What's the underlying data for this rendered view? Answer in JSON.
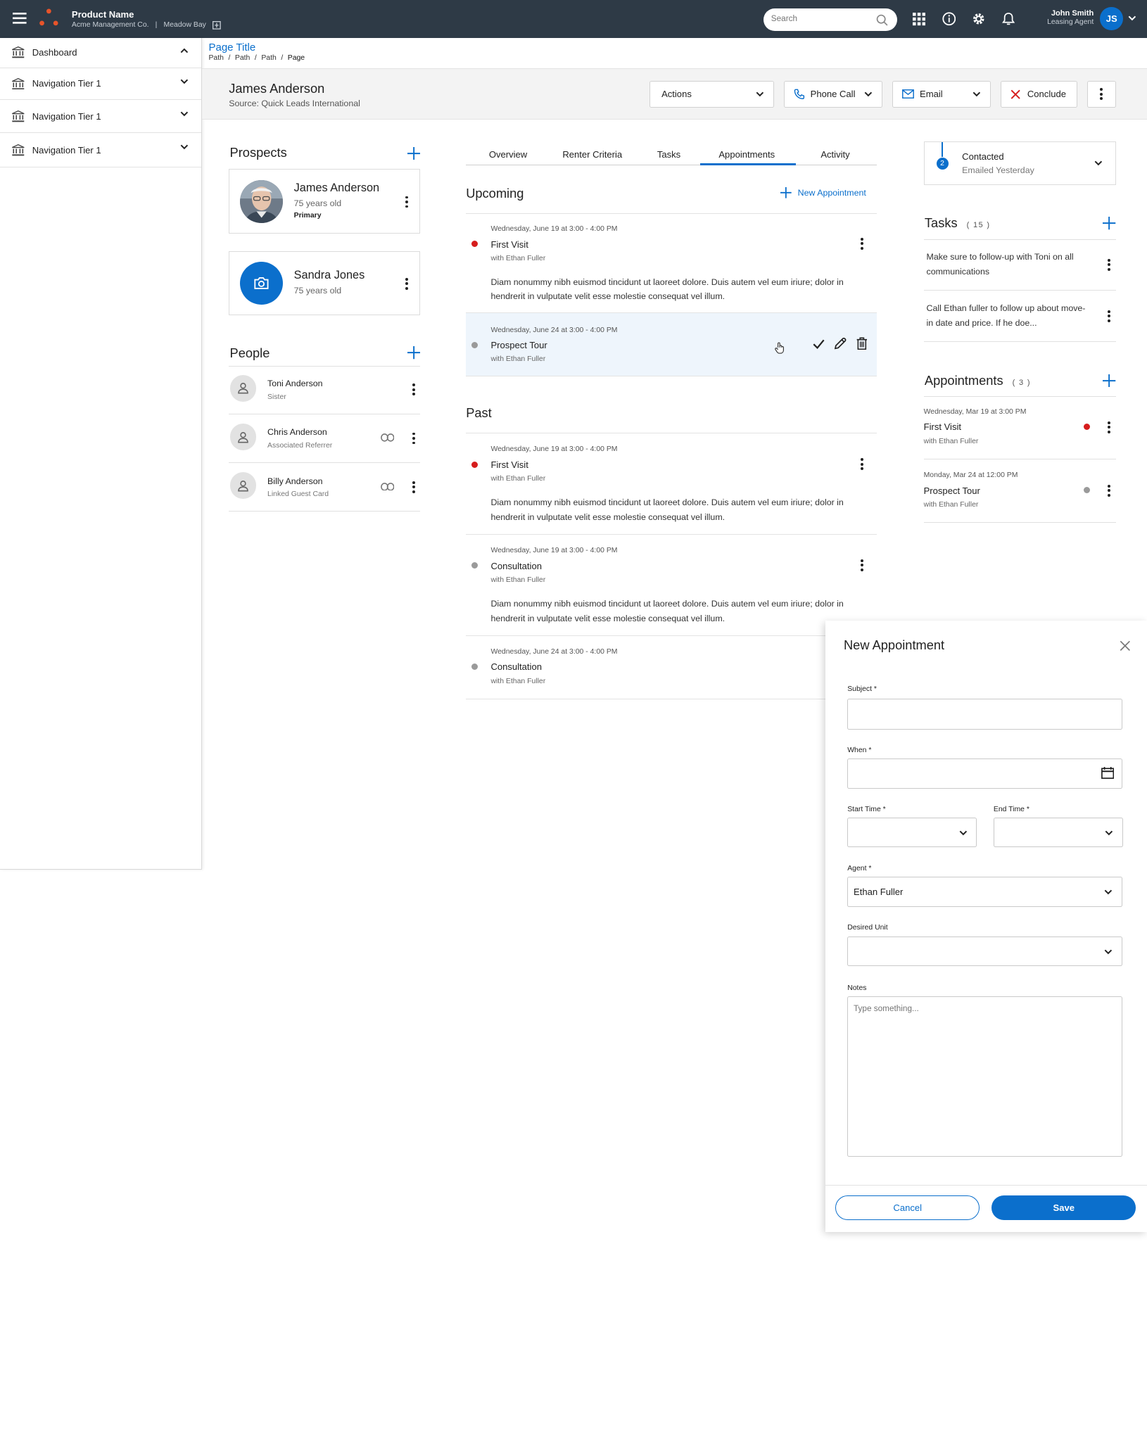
{
  "header": {
    "product_name": "Product Name",
    "company": "Acme Management Co.",
    "separator": "|",
    "property": "Meadow Bay",
    "search_placeholder": "Search",
    "user_name": "John Smith",
    "user_role": "Leasing Agent",
    "user_initials": "JS"
  },
  "sidebar": {
    "items": [
      {
        "label": "Dashboard",
        "expanded": true
      },
      {
        "label": "Navigation Tier 1",
        "expanded": false
      },
      {
        "label": "Navigation Tier 1",
        "expanded": false
      },
      {
        "label": "Navigation Tier 1",
        "expanded": false
      }
    ]
  },
  "page": {
    "title": "Page Title",
    "breadcrumb": [
      "Path",
      "Path",
      "Path",
      "Page"
    ],
    "breadcrumb_sep": "/"
  },
  "contact": {
    "name": "James Anderson",
    "source": "Source: Quick Leads International"
  },
  "toolbar": {
    "actions": "Actions",
    "phone": "Phone Call",
    "email": "Email",
    "conclude": "Conclude"
  },
  "prospects": {
    "title": "Prospects",
    "items": [
      {
        "name": "James Anderson",
        "age": "75 years old",
        "tag": "Primary"
      },
      {
        "name": "Sandra Jones",
        "age": "75 years old"
      }
    ]
  },
  "people": {
    "title": "People",
    "items": [
      {
        "name": "Toni Anderson",
        "relation": "Sister"
      },
      {
        "name": "Chris Anderson",
        "relation": "Associated Referrer"
      },
      {
        "name": "Billy Anderson",
        "relation": "Linked Guest Card"
      }
    ]
  },
  "tabs": [
    "Overview",
    "Renter Criteria",
    "Tasks",
    "Appointments",
    "Activity"
  ],
  "active_tab": "Appointments",
  "upcoming": {
    "title": "Upcoming",
    "new_label": "New Appointment",
    "items": [
      {
        "date": "Wednesday, June 19 at 3:00 - 4:00 PM",
        "title": "First Visit",
        "with": "with Ethan Fuller",
        "desc": "Diam nonummy nibh euismod tincidunt ut laoreet dolore. Duis autem vel eum iriure; dolor in hendrerit in vulputate velit esse molestie consequat vel illum.",
        "status": "red"
      },
      {
        "date": "Wednesday, June 24 at 3:00 - 4:00 PM",
        "title": "Prospect Tour",
        "with": "with Ethan Fuller",
        "status": "grey"
      }
    ]
  },
  "past": {
    "title": "Past",
    "items": [
      {
        "date": "Wednesday, June 19 at 3:00 - 4:00 PM",
        "title": "First Visit",
        "with": "with Ethan Fuller",
        "desc": "Diam nonummy nibh euismod tincidunt ut laoreet dolore. Duis autem vel eum iriure; dolor in hendrerit in vulputate velit esse molestie consequat vel illum.",
        "status": "red"
      },
      {
        "date": "Wednesday, June 19 at 3:00 - 4:00 PM",
        "title": "Consultation",
        "with": "with Ethan Fuller",
        "desc": "Diam nonummy nibh euismod tincidunt ut laoreet dolore. Duis autem vel eum iriure; dolor in hendrerit in vulputate velit esse molestie consequat vel illum.",
        "status": "grey"
      },
      {
        "date": "Wednesday, June 24 at 3:00 - 4:00 PM",
        "title": "Consultation",
        "with": "with Ethan Fuller",
        "status": "grey"
      }
    ]
  },
  "status_box": {
    "step": "2",
    "label": "Contacted",
    "sub": "Emailed Yesterday"
  },
  "tasks": {
    "title": "Tasks",
    "count": "( 15 )",
    "items": [
      "Make sure to follow-up with Toni on all communications",
      "Call Ethan fuller to follow up about move-in date and price. If he doe..."
    ]
  },
  "appointments": {
    "title": "Appointments",
    "count": "( 3 )",
    "items": [
      {
        "date": "Wednesday, Mar 19 at 3:00 PM",
        "title": "First Visit",
        "with": "with Ethan Fuller",
        "status": "red"
      },
      {
        "date": "Monday, Mar 24 at 12:00 PM",
        "title": "Prospect Tour",
        "with": "with Ethan Fuller",
        "status": "grey"
      }
    ]
  },
  "new_appointment": {
    "title": "New Appointment",
    "subject_label": "Subject *",
    "when_label": "When *",
    "start_label": "Start Time *",
    "end_label": "End Time *",
    "agent_label": "Agent *",
    "agent_value": "Ethan Fuller",
    "unit_label": "Desired Unit",
    "notes_label": "Notes",
    "notes_placeholder": "Type something...",
    "cancel": "Cancel",
    "save": "Save"
  },
  "colors": {
    "topbar": "#2e3a46",
    "accent": "#0b6fcc",
    "logo": "#e8542a",
    "status_red": "#d61d1d",
    "status_grey": "#9a9a9a",
    "hover_row": "#eef5fc"
  }
}
